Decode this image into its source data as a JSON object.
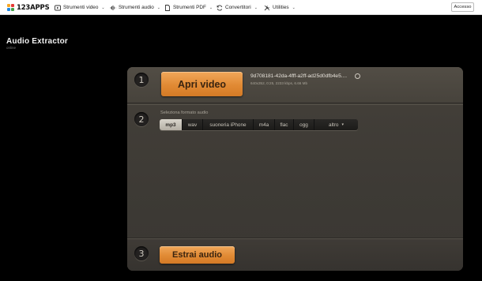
{
  "brand": {
    "name": "123APPS"
  },
  "nav": {
    "items": [
      {
        "label": "Strumenti video"
      },
      {
        "label": "Strumenti audio"
      },
      {
        "label": "Strumenti PDF"
      },
      {
        "label": "Convertitori"
      },
      {
        "label": "Utilities"
      }
    ],
    "login_label": "Accesso"
  },
  "page": {
    "title": "Audio Extractor",
    "subtitle": "online"
  },
  "steps": {
    "s1": {
      "num": "1",
      "button": "Apri video",
      "file_name": "9d708181-42da-4fff-a2ff-ad25d0dfb4e5....",
      "file_meta": "640x352, 0:25, 2233 kbps, 6.66 Mb"
    },
    "s2": {
      "num": "2",
      "label": "Seleziona formato audio",
      "formats": [
        "mp3",
        "wav",
        "suoneria iPhone",
        "m4a",
        "flac",
        "ogg",
        "altro"
      ],
      "selected": "mp3"
    },
    "s3": {
      "num": "3",
      "button": "Estrai audio"
    }
  },
  "colors": {
    "accent": "#e18a34",
    "panel": "#423e38",
    "background": "#000000"
  }
}
